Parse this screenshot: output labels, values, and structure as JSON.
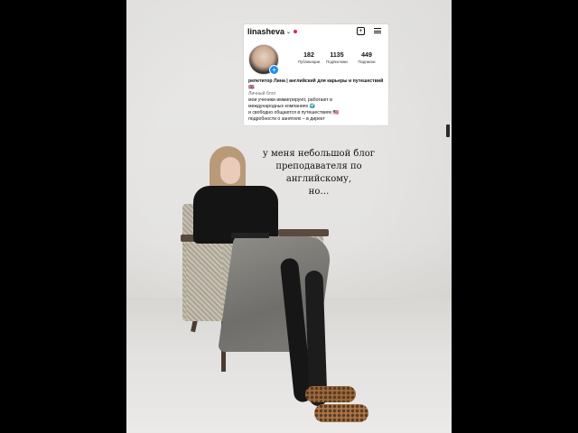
{
  "profile": {
    "username": "linasheva",
    "stats": [
      {
        "value": "182",
        "label": "Публикации"
      },
      {
        "value": "1135",
        "label": "Подписчики"
      },
      {
        "value": "449",
        "label": "Подписки"
      }
    ],
    "bio_name": "репетитор Лина | английский для карьеры и путешествий 🇬🇧",
    "bio_category": "Личный блог",
    "bio_lines": [
      "мои ученики иммигрируют, работают в",
      "международных компаниях 🌍",
      "и свободно общаются в путешествиях 🇺🇸",
      "подробности о занятиях – в директ"
    ]
  },
  "caption": {
    "lines": [
      "у меня небольшой блог",
      "преподавателя по",
      "английскому,",
      "но…"
    ]
  },
  "icons": {
    "new_post": "plus-square-icon",
    "menu": "hamburger-menu-icon",
    "avatar_badge": "plus-circle-icon"
  },
  "colors": {
    "badge_blue": "#1a8ef0",
    "live_dot": "#e0245e"
  }
}
